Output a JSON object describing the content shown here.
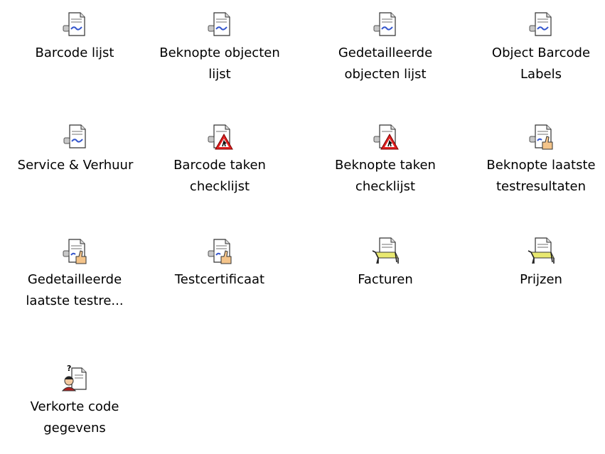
{
  "items": [
    {
      "label": "Barcode lijst",
      "icon": "report-icon"
    },
    {
      "label": "Beknopte objecten lijst",
      "icon": "report-icon"
    },
    {
      "label": "Gedetailleerde objecten lijst",
      "icon": "report-icon"
    },
    {
      "label": "Object Barcode Labels",
      "icon": "report-icon"
    },
    {
      "label": "Service & Verhuur",
      "icon": "report-icon"
    },
    {
      "label": "Barcode taken checklijst",
      "icon": "report-warning-icon"
    },
    {
      "label": "Beknopte taken checklijst",
      "icon": "report-warning-icon"
    },
    {
      "label": "Beknopte laatste testresultaten",
      "icon": "report-thumbsup-icon"
    },
    {
      "label": "Gedetailleerde laatste testre...",
      "icon": "report-thumbsup-icon"
    },
    {
      "label": "Testcertificaat",
      "icon": "report-thumbsup-icon"
    },
    {
      "label": "Facturen",
      "icon": "report-table-icon"
    },
    {
      "label": "Prijzen",
      "icon": "report-table-icon"
    },
    {
      "label": "Verkorte code gegevens",
      "icon": "report-person-icon"
    }
  ]
}
